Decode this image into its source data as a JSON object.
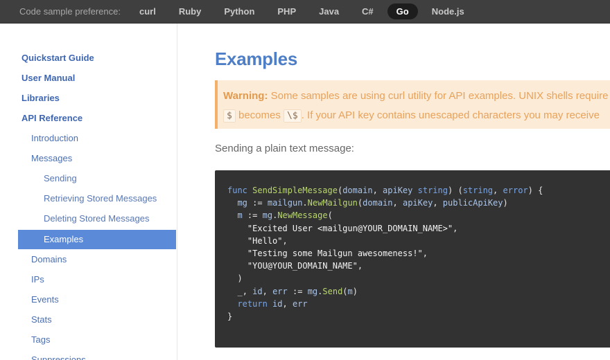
{
  "topbar": {
    "label": "Code sample preference:",
    "languages": [
      "curl",
      "Ruby",
      "Python",
      "PHP",
      "Java",
      "C#",
      "Go",
      "Node.js"
    ],
    "selected": "Go"
  },
  "sidebar": {
    "items": [
      {
        "label": "Quickstart Guide"
      },
      {
        "label": "User Manual"
      },
      {
        "label": "Libraries"
      },
      {
        "label": "API Reference"
      },
      {
        "label": "Introduction"
      },
      {
        "label": "Messages"
      },
      {
        "label": "Sending"
      },
      {
        "label": "Retrieving Stored Messages"
      },
      {
        "label": "Deleting Stored Messages"
      },
      {
        "label": "Examples"
      },
      {
        "label": "Domains"
      },
      {
        "label": "IPs"
      },
      {
        "label": "Events"
      },
      {
        "label": "Stats"
      },
      {
        "label": "Tags"
      },
      {
        "label": "Suppressions"
      }
    ],
    "active": "Examples"
  },
  "main": {
    "title": "Examples",
    "warning": {
      "bold": "Warning:",
      "line1": " Some samples are using curl utility for API examples. UNIX shells require that some characters be escaped, for example",
      "code1": "$",
      "becomes": " becomes ",
      "code2": "\\$",
      "line2": ". If your API key contains unescaped characters you may receive"
    },
    "intro": "Sending a plain text message:",
    "code": {
      "language": "Go",
      "lines": [
        "func SendSimpleMessage(domain, apiKey string) (string, error) {",
        "  mg := mailgun.NewMailgun(domain, apiKey, publicApiKey)",
        "  m := mg.NewMessage(",
        "    \"Excited User <mailgun@YOUR_DOMAIN_NAME>\",",
        "    \"Hello\",",
        "    \"Testing some Mailgun awesomeness!\",",
        "    \"YOU@YOUR_DOMAIN_NAME\",",
        "  )",
        "  _, id, err := mg.Send(m)",
        "  return id, err",
        "}"
      ]
    }
  },
  "colors": {
    "topbar_bg": "#3f3f3f",
    "link": "#3e66b0",
    "active_bg": "#5b8bd8",
    "title": "#4d7ec6",
    "warning_bg": "#fcebd7",
    "warning_text": "#e8a25a",
    "code_bg": "#323232"
  }
}
